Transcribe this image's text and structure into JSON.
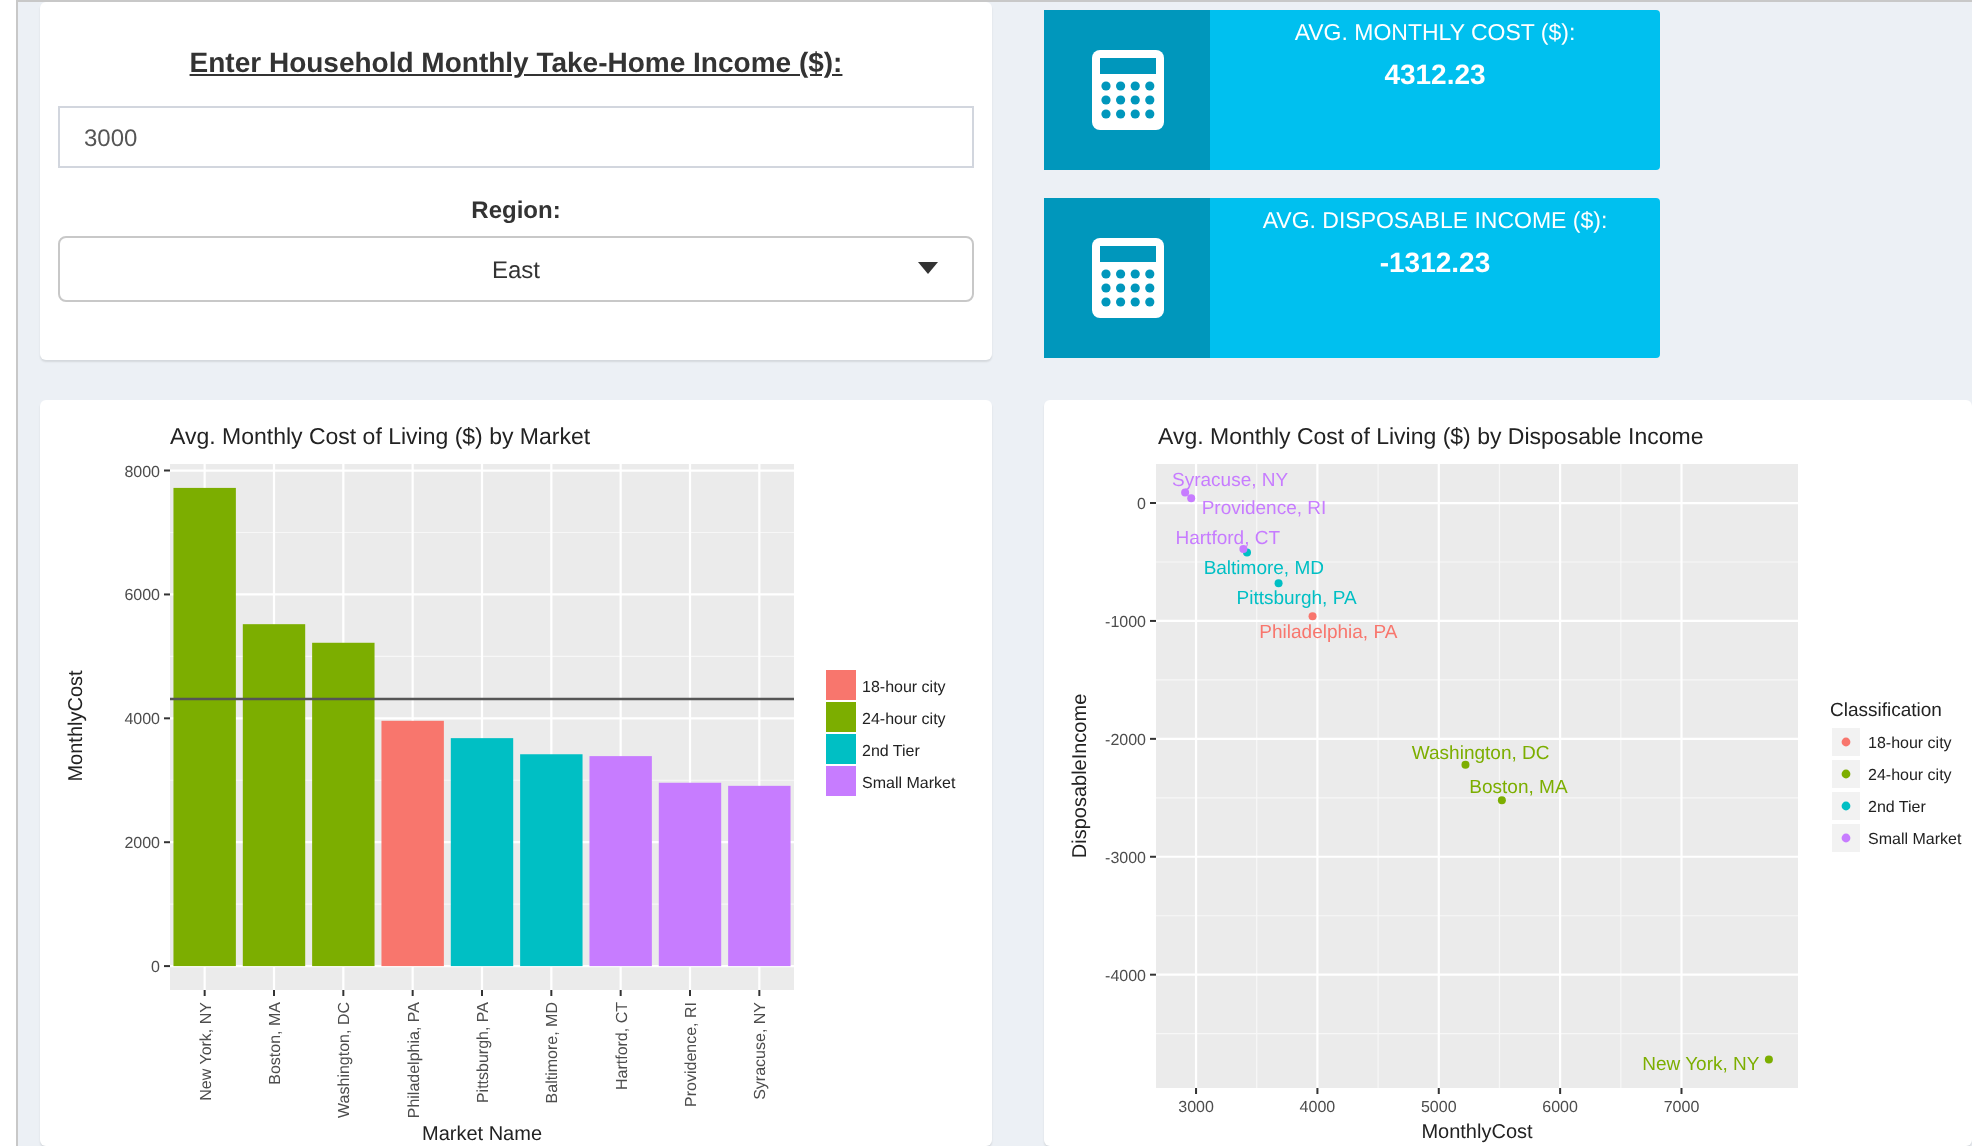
{
  "income_panel": {
    "heading": "Enter Household Monthly Take-Home Income ($):",
    "income_field": {
      "value": "3000"
    },
    "region_label": "Region:",
    "region_select": {
      "value": "East"
    }
  },
  "info_boxes": [
    {
      "title": "AVG. MONTHLY COST ($):",
      "value": "4312.23"
    },
    {
      "title": "AVG. DISPOSABLE INCOME ($):",
      "value": "-1312.23"
    }
  ],
  "bar_chart": {
    "chart_data": {
      "type": "bar",
      "title": "Avg. Monthly Cost of Living ($) by Market",
      "xlabel": "Market Name",
      "ylabel": "MonthlyCost",
      "categories": [
        "New York, NY",
        "Boston, MA",
        "Washington, DC",
        "Philadelphia, PA",
        "Pittsburgh, PA",
        "Baltimore, MD",
        "Hartford, CT",
        "Providence, RI",
        "Syracuse, NY"
      ],
      "series": [
        {
          "name": "18-hour city",
          "color": "#f8766d",
          "values": [
            null,
            null,
            null,
            3960,
            null,
            null,
            null,
            null,
            null
          ]
        },
        {
          "name": "24-hour city",
          "color": "#7cae00",
          "values": [
            7720,
            5520,
            5220,
            null,
            null,
            null,
            null,
            null,
            null
          ]
        },
        {
          "name": "2nd Tier",
          "color": "#00bfc4",
          "values": [
            null,
            null,
            null,
            null,
            3680,
            3420,
            null,
            null,
            null
          ]
        },
        {
          "name": "Small Market",
          "color": "#c77cff",
          "values": [
            null,
            null,
            null,
            null,
            null,
            null,
            3390,
            2960,
            2910
          ]
        }
      ],
      "ylim": [
        -386,
        8106
      ],
      "yticks": [
        0,
        2000,
        4000,
        6000,
        8000
      ],
      "stacked": true,
      "ref_lines": [
        {
          "axis": "y",
          "value": 4312.23
        }
      ],
      "grid": true,
      "legend": true
    }
  },
  "scatter_chart": {
    "chart_data": {
      "type": "scatter",
      "title": "Avg. Monthly Cost of Living ($) by Disposable Income",
      "xlabel": "MonthlyCost",
      "ylabel": "DisposableIncome",
      "x": [
        7720,
        5520,
        5220,
        3960,
        3680,
        3420,
        3390,
        2960,
        2910
      ],
      "series": [
        {
          "name": "18-hour city",
          "color": "#f8766d",
          "values": [
            null,
            null,
            null,
            -960,
            null,
            null,
            null,
            null,
            null
          ]
        },
        {
          "name": "24-hour city",
          "color": "#7cae00",
          "values": [
            -4720,
            -2520,
            -2220,
            null,
            null,
            null,
            null,
            null,
            null
          ]
        },
        {
          "name": "2nd Tier",
          "color": "#00bfc4",
          "values": [
            null,
            null,
            null,
            null,
            -680,
            -420,
            null,
            null,
            null
          ]
        },
        {
          "name": "Small Market",
          "color": "#c77cff",
          "values": [
            null,
            null,
            null,
            null,
            null,
            null,
            -390,
            40,
            90
          ]
        }
      ],
      "xlim": [
        2670,
        7960
      ],
      "ylim": [
        -4961,
        331
      ],
      "xticks": [
        3000,
        4000,
        5000,
        6000,
        7000
      ],
      "yticks": [
        -4000,
        -3000,
        -2000,
        -1000,
        0
      ],
      "grid": true,
      "legend": {
        "title": "Classification"
      },
      "annotations": [
        "New York, NY",
        "Boston, MA",
        "Washington, DC",
        "Philadelphia, PA",
        "Pittsburgh, PA",
        "Baltimore, MD",
        "Hartford, CT",
        "Providence, RI",
        "Syracuse, NY"
      ]
    }
  }
}
